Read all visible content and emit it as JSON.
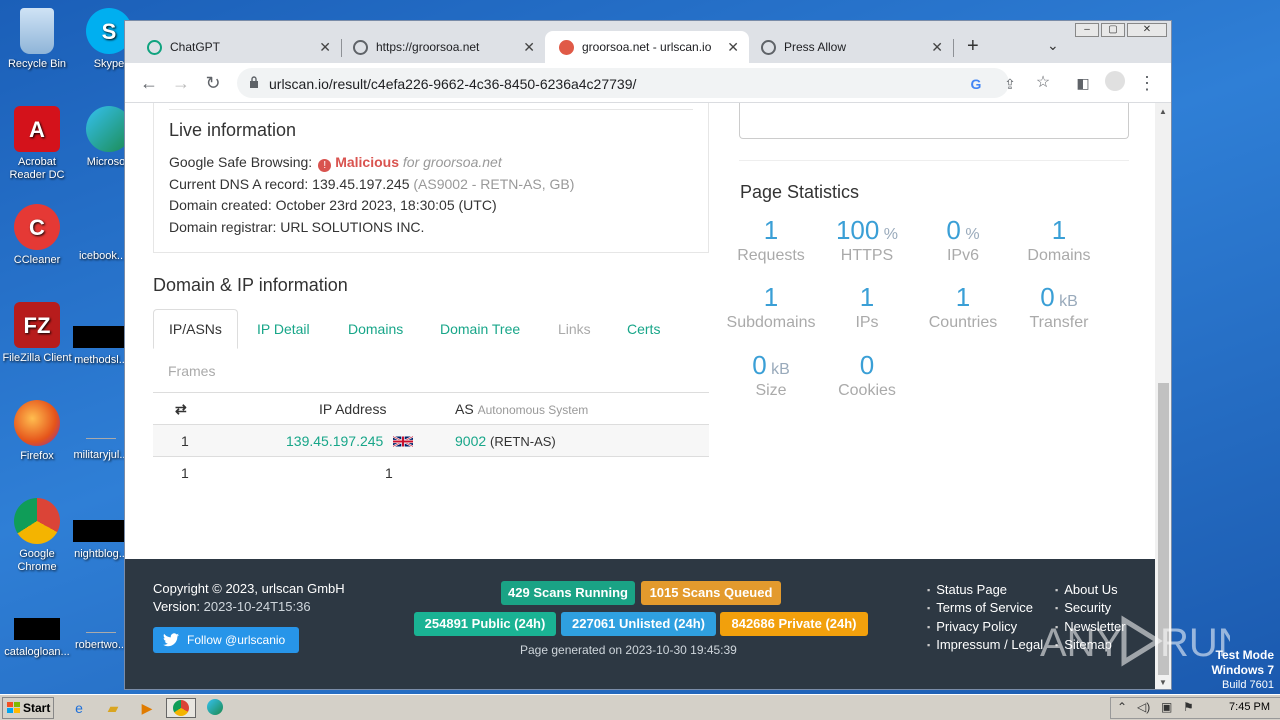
{
  "desktop": {
    "icons": [
      {
        "label": "Recycle Bin"
      },
      {
        "label": "Skype"
      },
      {
        "label": "Acrobat Reader DC"
      },
      {
        "label": "Microsoft"
      },
      {
        "label": "CCleaner"
      },
      {
        "label": "icebook.."
      },
      {
        "label": "FileZilla Client"
      },
      {
        "label": "methodsl..."
      },
      {
        "label": "Firefox"
      },
      {
        "label": "militaryjul..."
      },
      {
        "label": "Google Chrome"
      },
      {
        "label": "nightblog..."
      },
      {
        "label": "catalogloan..."
      },
      {
        "label": "robertwo..."
      }
    ]
  },
  "browser": {
    "tabs": [
      {
        "title": "ChatGPT",
        "icon": "chatgpt-icon"
      },
      {
        "title": "https://groorsoa.net",
        "icon": "globe-icon"
      },
      {
        "title": "groorsoa.net - urlscan.io",
        "icon": "urlscan-icon"
      },
      {
        "title": "Press Allow",
        "icon": "globe-icon"
      }
    ],
    "url": "urlscan.io/result/c4efa226-9662-4c36-8450-6236a4c27739/"
  },
  "live_info": {
    "title": "Live information",
    "safe_browsing_label": "Google Safe Browsing:",
    "safe_browsing_value": "Malicious",
    "safe_browsing_for": "for groorsoa.net",
    "dns_label": "Current DNS A record: 139.45.197.245",
    "dns_as": "(AS9002 - RETN-AS, GB)",
    "created": "Domain created: October 23rd 2023, 18:30:05 (UTC)",
    "registrar": "Domain registrar: URL SOLUTIONS INC."
  },
  "domain_ip": {
    "title": "Domain & IP information",
    "tabs": [
      "IP/ASNs",
      "IP Detail",
      "Domains",
      "Domain Tree",
      "Links",
      "Certs",
      "Frames"
    ],
    "table": {
      "header_ip": "IP Address",
      "header_as": "AS",
      "header_as_sub": "Autonomous System",
      "rows": [
        {
          "count": "1",
          "ip": "139.45.197.245",
          "as_num": "9002",
          "as_name": "(RETN-AS)"
        },
        {
          "count": "1",
          "ip": "1",
          "as_num": "",
          "as_name": ""
        }
      ]
    }
  },
  "page_stats": {
    "title": "Page Statistics",
    "items": [
      {
        "value": "1",
        "unit": "",
        "label": "Requests"
      },
      {
        "value": "100",
        "unit": "%",
        "label": "HTTPS"
      },
      {
        "value": "0",
        "unit": "%",
        "label": "IPv6"
      },
      {
        "value": "1",
        "unit": "",
        "label": "Domains"
      },
      {
        "value": "1",
        "unit": "",
        "label": "Subdomains"
      },
      {
        "value": "1",
        "unit": "",
        "label": "IPs"
      },
      {
        "value": "1",
        "unit": "",
        "label": "Countries"
      },
      {
        "value": "0",
        "unit": "kB",
        "label": "Transfer"
      },
      {
        "value": "0",
        "unit": "kB",
        "label": "Size"
      },
      {
        "value": "0",
        "unit": "",
        "label": "Cookies"
      }
    ]
  },
  "footer": {
    "copyright": "Copyright © 2023, urlscan GmbH",
    "version_label": "Version:",
    "version": "2023-10-24T15:36",
    "twitter": "Follow @urlscanio",
    "badges": [
      {
        "text": "429 Scans Running",
        "color": "#1aa385"
      },
      {
        "text": "1015 Scans Queued",
        "color": "#e39a2d"
      },
      {
        "text": "254891 Public (24h)",
        "color": "#1ab394"
      },
      {
        "text": "227061 Unlisted (24h)",
        "color": "#2fa0e0"
      },
      {
        "text": "842686 Private (24h)",
        "color": "#f2a00c"
      }
    ],
    "generated": "Page generated on 2023-10-30 19:45:39",
    "links_col1": [
      "Status Page",
      "Terms of Service",
      "Privacy Policy",
      "Impressum / Legal"
    ],
    "links_col2": [
      "About Us",
      "Security",
      "Newsletter",
      "Sitemap"
    ]
  },
  "watermark": {
    "test_mode": "Test Mode",
    "os": "Windows 7",
    "build": "Build 7601"
  },
  "taskbar": {
    "start": "Start",
    "clock": "7:45 PM"
  }
}
